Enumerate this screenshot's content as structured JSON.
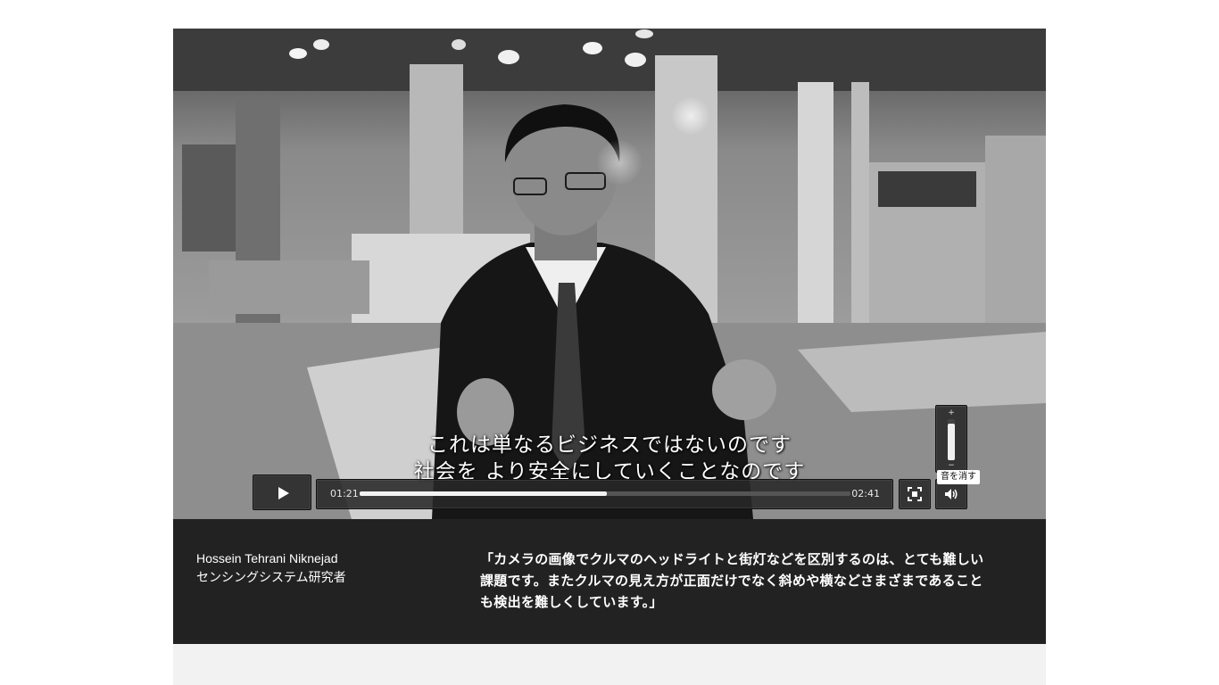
{
  "video": {
    "subtitle_lines": [
      "これは単なるビジネスではないのです",
      "社会を より安全にしていくことなのです"
    ],
    "current_time": "01:21",
    "total_time": "02:41",
    "progress": 0.503,
    "volume_level": 0.9,
    "mute_tooltip": "音を消す",
    "volume_plus": "+",
    "volume_minus": "−",
    "icons": {
      "play": "play-icon",
      "fullscreen": "fullscreen-icon",
      "volume": "volume-icon"
    }
  },
  "info": {
    "person_name": "Hossein Tehrani Niknejad",
    "person_title": "センシングシステム研究者",
    "quote_lines": [
      "「カメラの画像でクルマのヘッドライトと街灯などを区別するのは、とても難しい",
      "課題です。またクルマの見え方が正面だけでなく斜めや横などさまざまであること",
      "も検出を難しくしています。」"
    ]
  },
  "colors": {
    "info_background": "#222222",
    "below_background": "#f2f2f2",
    "control_background": "#282828"
  }
}
